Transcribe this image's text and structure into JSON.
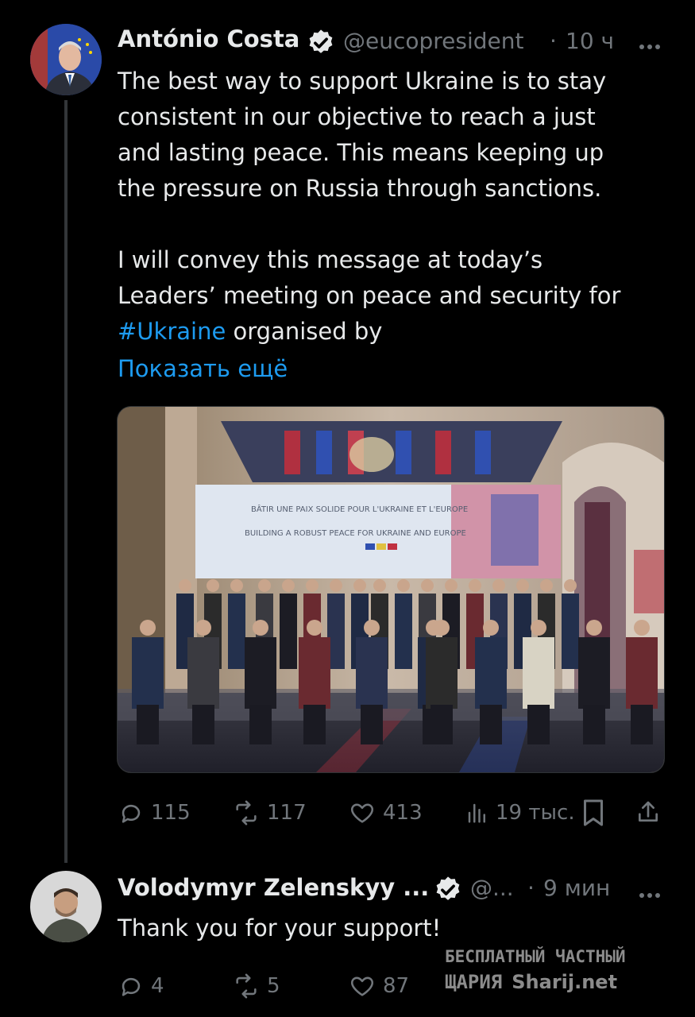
{
  "colors": {
    "background": "#000000",
    "text": "#e7e9ea",
    "secondary": "#71767b",
    "link": "#1d9bf0",
    "thread_line": "#333639"
  },
  "tweet1": {
    "author_name": "António Costa",
    "handle": "@eucopresident",
    "separator": "·",
    "time": "10 ч",
    "more_icon": "ellipsis-icon",
    "verified_icon": "verified-badge-icon",
    "text_lines": [
      "The best way to support Ukraine is to stay",
      "consistent in our objective to reach a just",
      "and lasting peace. This means keeping up",
      "the pressure on Russia through sanctions."
    ],
    "text_lines_2": [
      "I will convey this message at today’s",
      "Leaders’ meeting on peace and security for"
    ],
    "hashtag": "#Ukraine",
    "after_hashtag": " organised by",
    "show_more": "Показать ещё",
    "photo": {
      "banner_line_1": "BÂTIR UNE PAIX SOLIDE POUR L'UKRAINE ET L'EUROPE",
      "banner_line_2": "BUILDING A ROBUST PEACE FOR UKRAINE AND EUROPE"
    },
    "actions": {
      "replies": "115",
      "reposts": "117",
      "likes": "413",
      "views": "19 тыс."
    }
  },
  "tweet2": {
    "author_name": "Volodymyr Zelenskyy ...",
    "handle": "@...",
    "separator": "·",
    "time": "9 мин",
    "text": "Thank you for your support!",
    "actions": {
      "replies": "4",
      "reposts": "5",
      "likes": "87"
    }
  },
  "watermark": {
    "line1": "БЕСПЛАТНЫЙ ЧАСТНЫЙ",
    "line2": "ЩАРИЯ",
    "line3": "Sharij.net"
  }
}
